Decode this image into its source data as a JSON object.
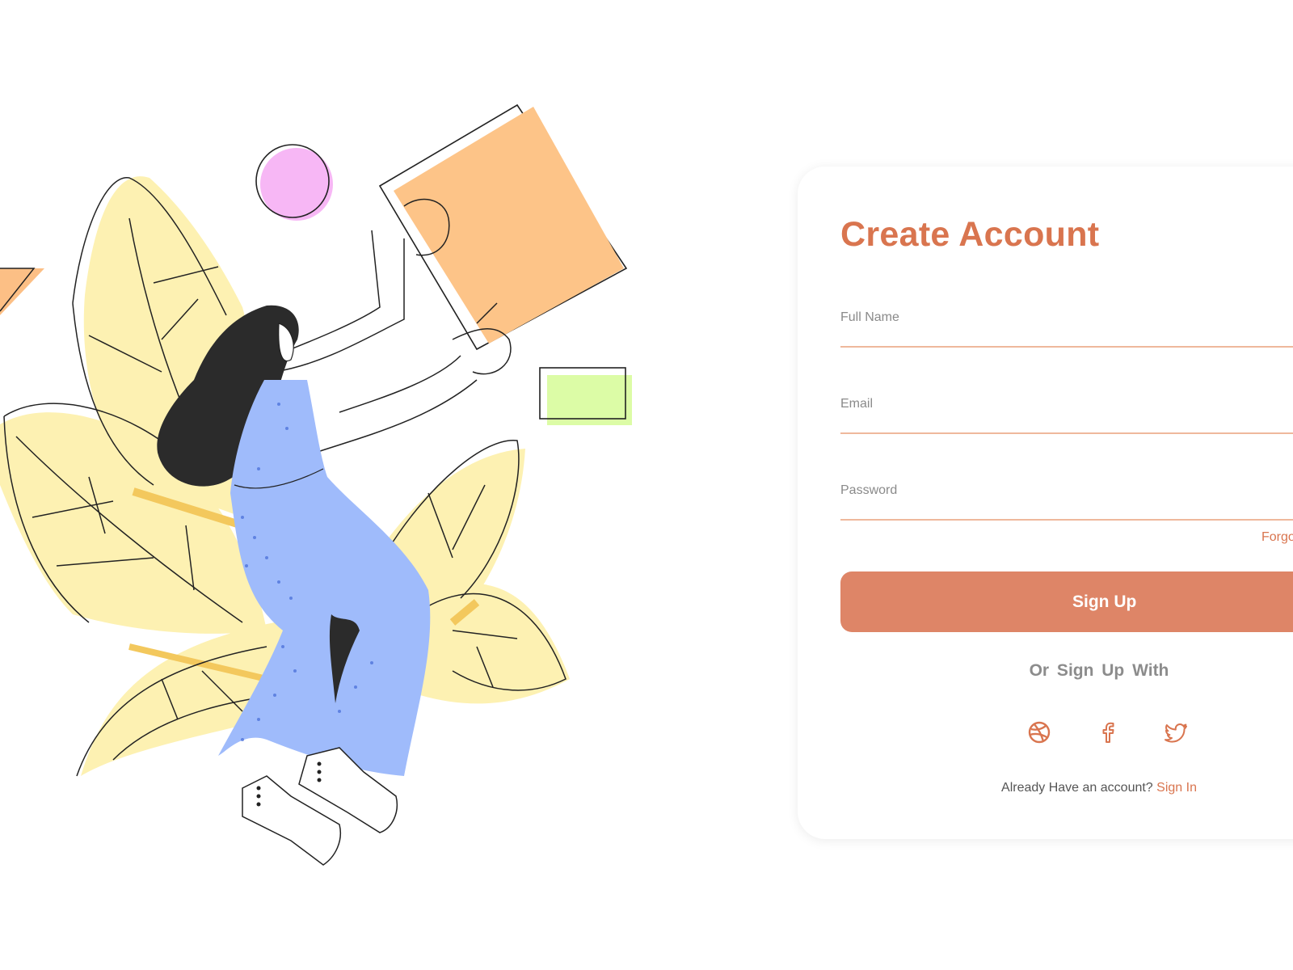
{
  "theme": {
    "accent": "#d9754f",
    "button": "#de8567",
    "underline": "#efb89c",
    "muted": "#8a8a8a"
  },
  "form": {
    "title": "Create Account",
    "fields": [
      {
        "label": "Full Name",
        "value": "",
        "type": "text"
      },
      {
        "label": "Email",
        "value": "",
        "type": "email"
      },
      {
        "label": "Password",
        "value": "",
        "type": "password"
      }
    ],
    "forgot_label": "Forgo",
    "submit_label": "Sign Up",
    "or_text": "Or  Sign Up With",
    "social": [
      {
        "name": "dribbble-icon"
      },
      {
        "name": "facebook-icon"
      },
      {
        "name": "twitter-icon"
      }
    ],
    "account_prompt": "Already Have an account?",
    "signin_label": "Sign In"
  }
}
